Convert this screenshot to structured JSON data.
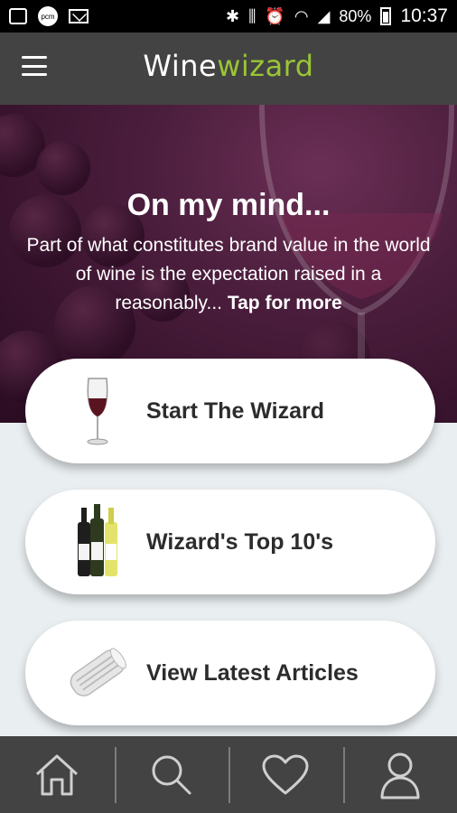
{
  "status_bar": {
    "icons": [
      "image-icon",
      "pvm-icon",
      "mail-icon",
      "bluetooth-icon",
      "vibrate-icon",
      "alarm-icon",
      "wifi-icon",
      "signal-icon",
      "battery-icon"
    ],
    "pvm_text": "pcm",
    "battery": "80%",
    "time": "10:37"
  },
  "app_bar": {
    "logo_wine": "Wine",
    "logo_wizard": "wizard",
    "colors": {
      "wine": "#ffffff",
      "wizard": "#9ac534",
      "bar": "#434343"
    }
  },
  "hero": {
    "title": "On my mind...",
    "text": "Part of what constitutes brand value in the world of wine is the expectation raised in a reasonably...",
    "more": "Tap for more"
  },
  "cards": [
    {
      "label": "Start The Wizard",
      "icon": "wine-glass-icon"
    },
    {
      "label": "Wizard's Top 10's",
      "icon": "wine-bottles-icon"
    },
    {
      "label": "View Latest Articles",
      "icon": "newspaper-icon"
    }
  ],
  "bottom_nav": {
    "items": [
      "home-icon",
      "search-icon",
      "heart-icon",
      "profile-icon"
    ]
  }
}
